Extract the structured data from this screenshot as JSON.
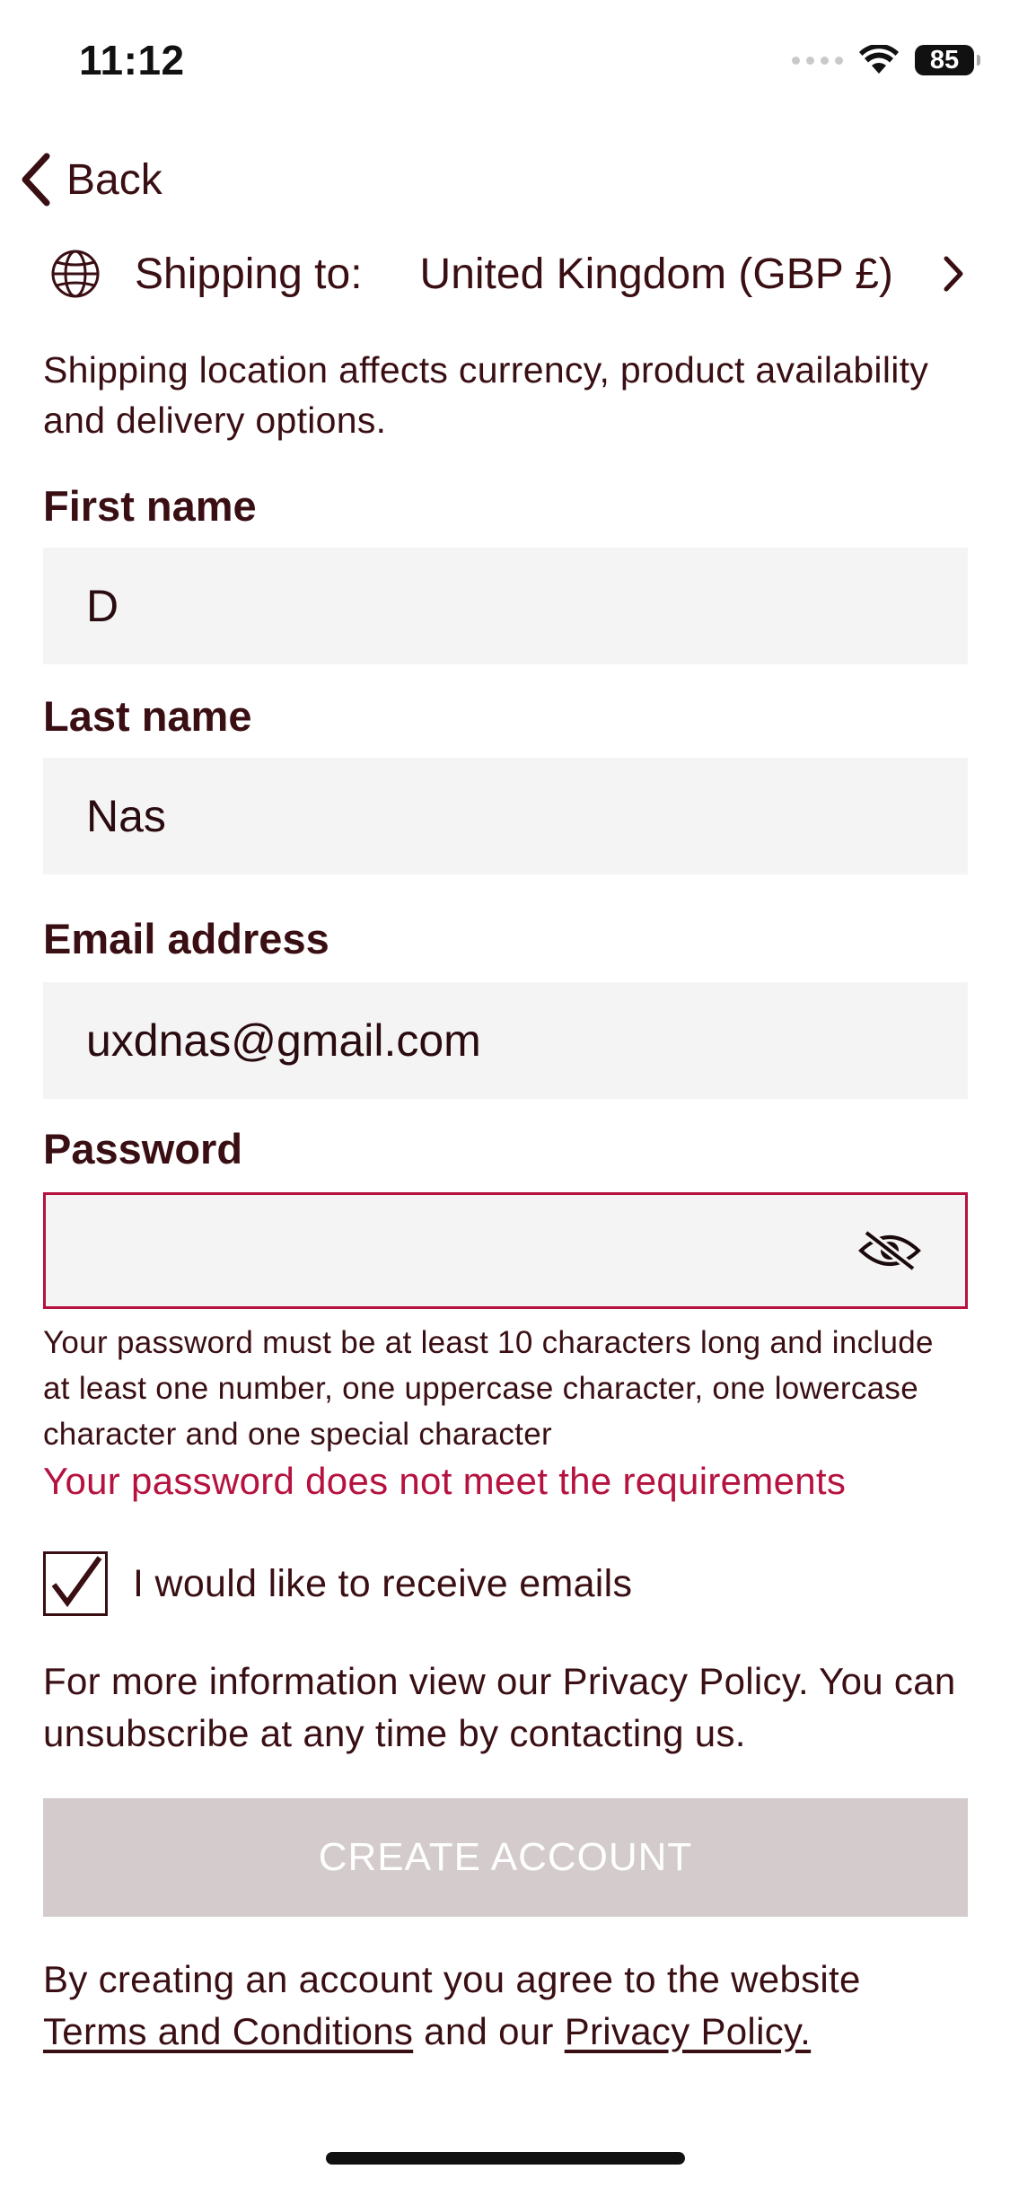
{
  "status_bar": {
    "time": "11:12",
    "battery": "85",
    "icons": [
      "cellular-signal-icon",
      "wifi-icon",
      "battery-icon"
    ]
  },
  "nav": {
    "back_label": "Back",
    "back_icon": "chevron-left-icon"
  },
  "shipping": {
    "icon": "globe-icon",
    "label": "Shipping to:",
    "value": "United Kingdom (GBP £)",
    "chevron_icon": "chevron-right-icon",
    "note": "Shipping location affects currency, product availability and delivery options."
  },
  "form": {
    "first_name": {
      "label": "First name",
      "value": "D"
    },
    "last_name": {
      "label": "Last name",
      "value": "Nas"
    },
    "email": {
      "label": "Email address",
      "value": "uxdnas@gmail.com"
    },
    "password": {
      "label": "Password",
      "value": "",
      "visibility_icon": "eye-slash-icon",
      "hint": "Your password must be at least 10 characters long and include at least one number, one uppercase character, one lowercase character and one special character",
      "error": "Your password does not meet the requirements"
    },
    "email_optin": {
      "label": "I would like to receive emails",
      "checked": true
    },
    "privacy_note": "For more information view our Privacy Policy. You can unsubscribe at any time by contacting us.",
    "submit_label": "CREATE ACCOUNT",
    "terms_prefix": " By creating an account you agree to the website",
    "terms_link": "Terms and Conditions",
    "terms_middle": " and our ",
    "privacy_link": "Privacy Policy."
  },
  "colors": {
    "text": "#3a0f14",
    "error": "#b5123f",
    "field_bg": "#f4f4f4",
    "button_disabled_bg": "#d4cccc"
  }
}
